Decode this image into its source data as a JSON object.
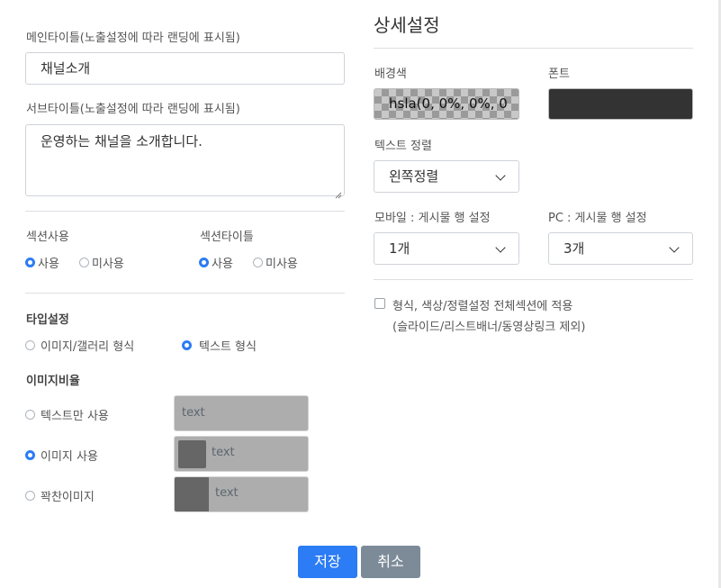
{
  "main_title": {
    "label": "메인타이틀(노출설정에 따라 랜딩에 표시됨)",
    "value": "채널소개"
  },
  "sub_title": {
    "label": "서브타이틀(노출설정에 따라 랜딩에 표시됨)",
    "value": "운영하는 채널을 소개합니다."
  },
  "section_use": {
    "label": "섹션사용",
    "options": [
      "사용",
      "미사용"
    ],
    "selected": "사용"
  },
  "section_title": {
    "label": "섹션타이틀",
    "options": [
      "사용",
      "미사용"
    ],
    "selected": "사용"
  },
  "type_setting": {
    "label": "타입설정",
    "options": [
      "이미지/갤러리 형식",
      "텍스트 형식"
    ],
    "selected": "텍스트 형식"
  },
  "image_ratio": {
    "label": "이미지비율",
    "options": [
      "텍스트만 사용",
      "이미지 사용",
      "꽉찬이미지"
    ],
    "selected": "이미지 사용",
    "preview_text": "text"
  },
  "detail": {
    "title": "상세설정",
    "bg_color": {
      "label": "배경색",
      "value": "hsla(0, 0%, 0%, 0"
    },
    "font": {
      "label": "폰트",
      "color": "#333333"
    },
    "text_align": {
      "label": "텍스트 정렬",
      "value": "왼쪽정렬"
    },
    "mobile_rows": {
      "label": "모바일 : 게시물 행 설정",
      "value": "1개"
    },
    "pc_rows": {
      "label": "PC : 게시물 행 설정",
      "value": "3개"
    },
    "apply_all": {
      "line1": "형식, 색상/정렬설정 전체섹션에 적용",
      "line2": "(슬라이드/리스트배너/동영상링크 제외)",
      "checked": false
    }
  },
  "buttons": {
    "save": "저장",
    "cancel": "취소"
  },
  "colors": {
    "accent": "#2b7cf5",
    "cancel": "#7d8b99",
    "swatch_dark": "#666666"
  }
}
